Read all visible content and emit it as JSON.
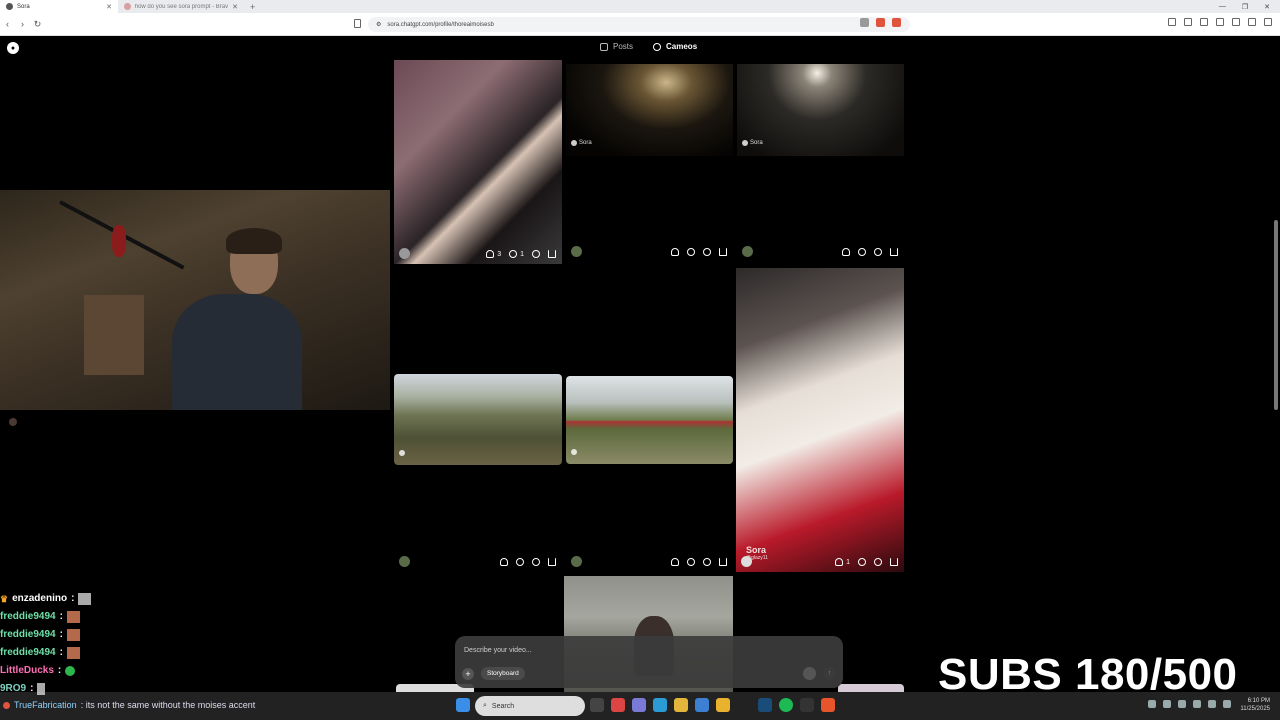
{
  "browser": {
    "tabs": [
      {
        "label": "Sora",
        "active": true
      },
      {
        "label": "how do you see sora prompt - Brave",
        "active": false
      }
    ],
    "new_tab": "+",
    "url": "sora.chatgpt.com/profile/thoreaimoisesb"
  },
  "page": {
    "tabs": [
      {
        "label": "Posts"
      },
      {
        "label": "Cameos"
      }
    ],
    "cards": [
      {
        "likes": "3",
        "comments": "1"
      },
      {
        "likes": "",
        "comments": ""
      },
      {
        "likes": "",
        "comments": ""
      },
      {
        "likes": "",
        "comments": ""
      },
      {
        "likes": "",
        "comments": ""
      },
      {
        "likes": "1",
        "comments": ""
      }
    ],
    "watermark": "Sora",
    "watermark_handle": "@glazy11"
  },
  "prompt": {
    "placeholder": "Describe your video...",
    "storyboard": "Storyboard",
    "plus": "+",
    "send": "↑"
  },
  "chat": [
    {
      "user": "enzadenino",
      "sep": ":"
    },
    {
      "user": "freddie9494",
      "sep": ":"
    },
    {
      "user": "freddie9494",
      "sep": ":"
    },
    {
      "user": "freddie9494",
      "sep": ":"
    },
    {
      "user": "LittleDucks",
      "sep": ":"
    },
    {
      "user": "9RO9",
      "sep": ":"
    }
  ],
  "ticker": {
    "user": "TrueFabrication",
    "text": ": its not the same without the moises accent"
  },
  "overlay": {
    "subs": "SUBS 180/500"
  },
  "taskbar": {
    "search": "Search",
    "time": "6:10 PM",
    "date": "11/25/2025"
  }
}
